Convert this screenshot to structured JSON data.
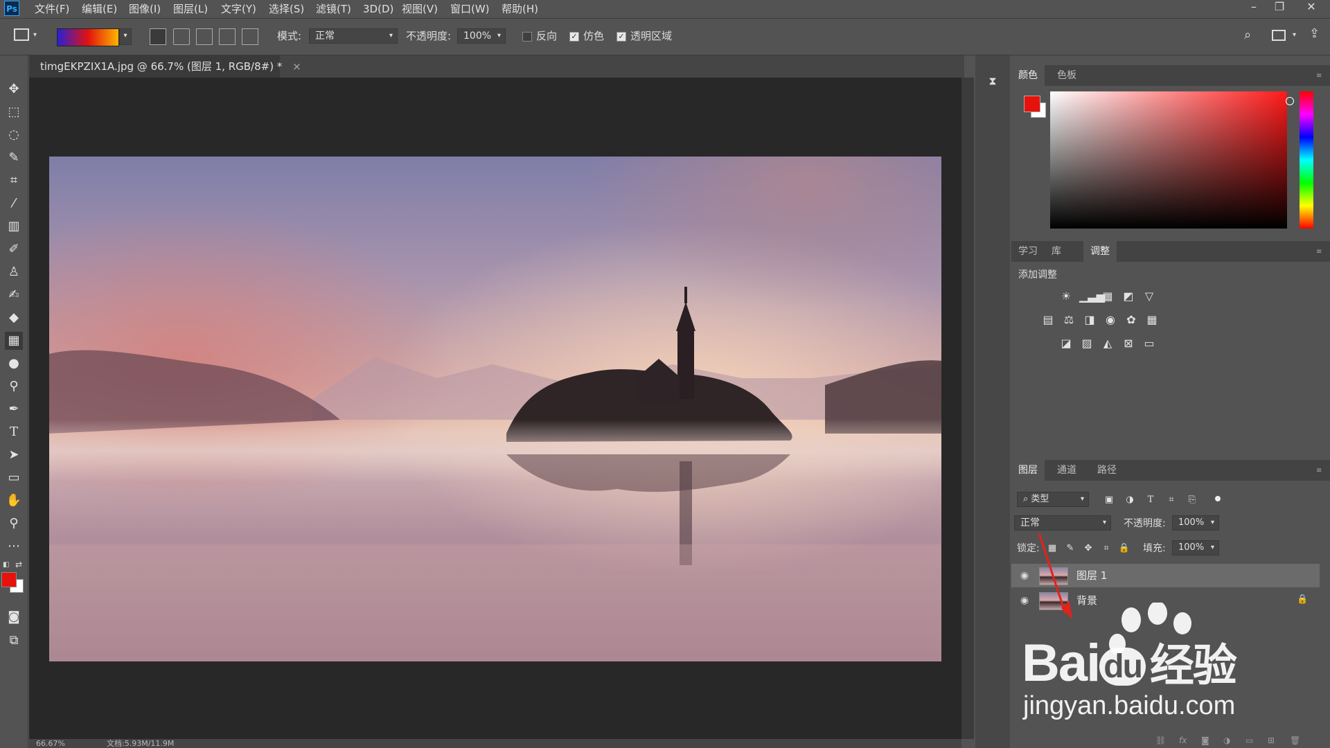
{
  "app": {
    "logo": "Ps"
  },
  "menu": [
    "文件(F)",
    "编辑(E)",
    "图像(I)",
    "图层(L)",
    "文字(Y)",
    "选择(S)",
    "滤镜(T)",
    "3D(D)",
    "视图(V)",
    "窗口(W)",
    "帮助(H)"
  ],
  "options": {
    "mode_label": "模式:",
    "mode_value": "正常",
    "opacity_label": "不透明度:",
    "opacity_value": "100%",
    "reverse_label": "反向",
    "dither_label": "仿色",
    "transparency_label": "透明区域",
    "reverse_checked": false,
    "dither_checked": true,
    "transparency_checked": true,
    "gradient_colors": [
      "#2b1fd6",
      "#e0120f",
      "#ffb400"
    ]
  },
  "document": {
    "tab_title": "timgEKPZIX1A.jpg @ 66.7% (图层 1, RGB/8#) *",
    "close_glyph": "×",
    "zoom": "66.67%",
    "doc_info": "文档:5.93M/11.9M"
  },
  "colors": {
    "foreground": "#e8120c",
    "background": "#ffffff"
  },
  "color_panel": {
    "tabs": [
      "颜色",
      "色板"
    ],
    "active_tab": "颜色",
    "hue_color": "#ff1a1a"
  },
  "adjust_panel": {
    "tabs": [
      "学习",
      "库",
      "调整"
    ],
    "active_tab": "调整",
    "heading": "添加调整",
    "icons_row1": [
      "brightness-icon",
      "levels-icon",
      "curves-icon",
      "exposure-icon",
      "vibrance-icon"
    ],
    "icons_row2": [
      "hsl-icon",
      "color-balance-icon",
      "black-white-icon",
      "photo-filter-icon",
      "channel-mixer-icon",
      "color-lookup-icon"
    ],
    "icons_row3": [
      "invert-icon",
      "posterize-icon",
      "threshold-icon",
      "selective-color-icon",
      "gradient-map-icon"
    ]
  },
  "layers_panel": {
    "tabs": [
      "图层",
      "通道",
      "路径"
    ],
    "active_tab": "图层",
    "filter_label": "类型",
    "blend_mode": "正常",
    "opacity_label": "不透明度:",
    "opacity_value": "100%",
    "lock_label": "锁定:",
    "fill_label": "填充:",
    "fill_value": "100%",
    "layers": [
      {
        "name": "图层 1",
        "selected": true,
        "locked": false
      },
      {
        "name": "背景",
        "selected": false,
        "locked": true
      }
    ]
  },
  "watermark": {
    "brand": "Bai",
    "brand_du": "du",
    "brand_cn": "经验",
    "url": "jingyan.baidu.com"
  }
}
